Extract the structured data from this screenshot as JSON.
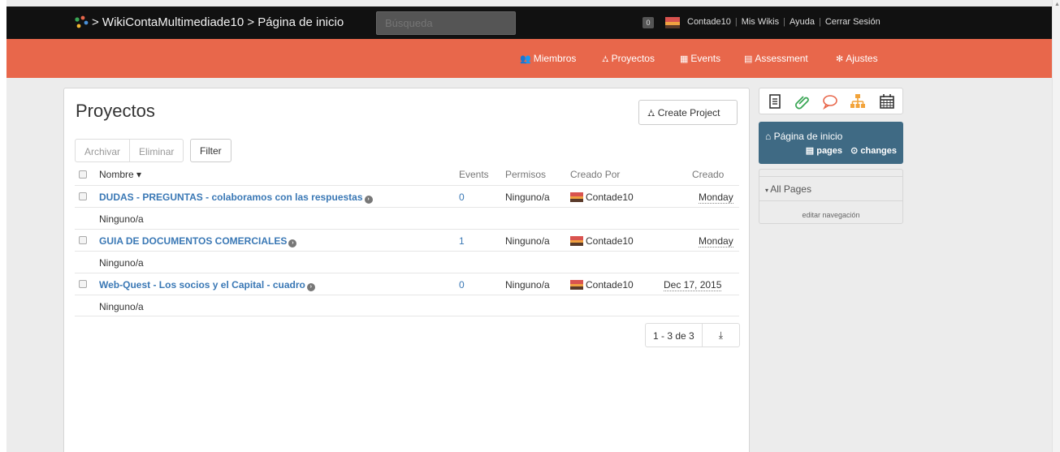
{
  "topbar": {
    "breadcrumb": "> WikiContaMultimediade10 > Página de inicio",
    "search_placeholder": "Búsqueda",
    "notif_count": "0",
    "user": "Contade10",
    "links": [
      "Mis Wikis",
      "Ayuda",
      "Cerrar Sesión"
    ]
  },
  "nav": {
    "items": [
      {
        "icon": "group-icon",
        "glyph": "👥",
        "label": "Miembros"
      },
      {
        "icon": "sitemap-icon",
        "glyph": "⛼",
        "label": "Proyectos"
      },
      {
        "icon": "calendar-icon",
        "glyph": "▦",
        "label": "Events"
      },
      {
        "icon": "chart-icon",
        "glyph": "▤",
        "label": "Assessment"
      },
      {
        "icon": "gear-icon",
        "glyph": "✻",
        "label": "Ajustes"
      }
    ]
  },
  "main": {
    "title": "Proyectos",
    "create_label": "Create Project",
    "actions": [
      "Archivar",
      "Eliminar"
    ],
    "filter_label": "Filter",
    "columns": {
      "name": "Nombre ▾",
      "events": "Events",
      "permisos": "Permisos",
      "creado_por": "Creado Por",
      "creado": "Creado"
    },
    "rows": [
      {
        "title": "DUDAS - PREGUNTAS - colaboramos con las respuestas",
        "events": "0",
        "permisos": "Ninguno/a",
        "creator": "Contade10",
        "created": "Monday",
        "desc": "Ninguno/a"
      },
      {
        "title": "GUIA DE DOCUMENTOS COMERCIALES",
        "events": "1",
        "permisos": "Ninguno/a",
        "creator": "Contade10",
        "created": "Monday",
        "desc": "Ninguno/a"
      },
      {
        "title": "Web-Quest - Los socios y el Capital - cuadro",
        "events": "0",
        "permisos": "Ninguno/a",
        "creator": "Contade10",
        "created": "Dec 17, 2015",
        "desc": "Ninguno/a"
      }
    ],
    "pager": "1 - 3 de 3"
  },
  "side": {
    "home_label": "Página de inicio",
    "pages_label": "pages",
    "changes_label": "changes",
    "all_pages": "All Pages",
    "edit_nav": "editar navegación"
  },
  "colors": {
    "topbar": "#111111",
    "navbar": "#e8674b",
    "link": "#3a78b5",
    "sidenav": "#3f6a84"
  }
}
